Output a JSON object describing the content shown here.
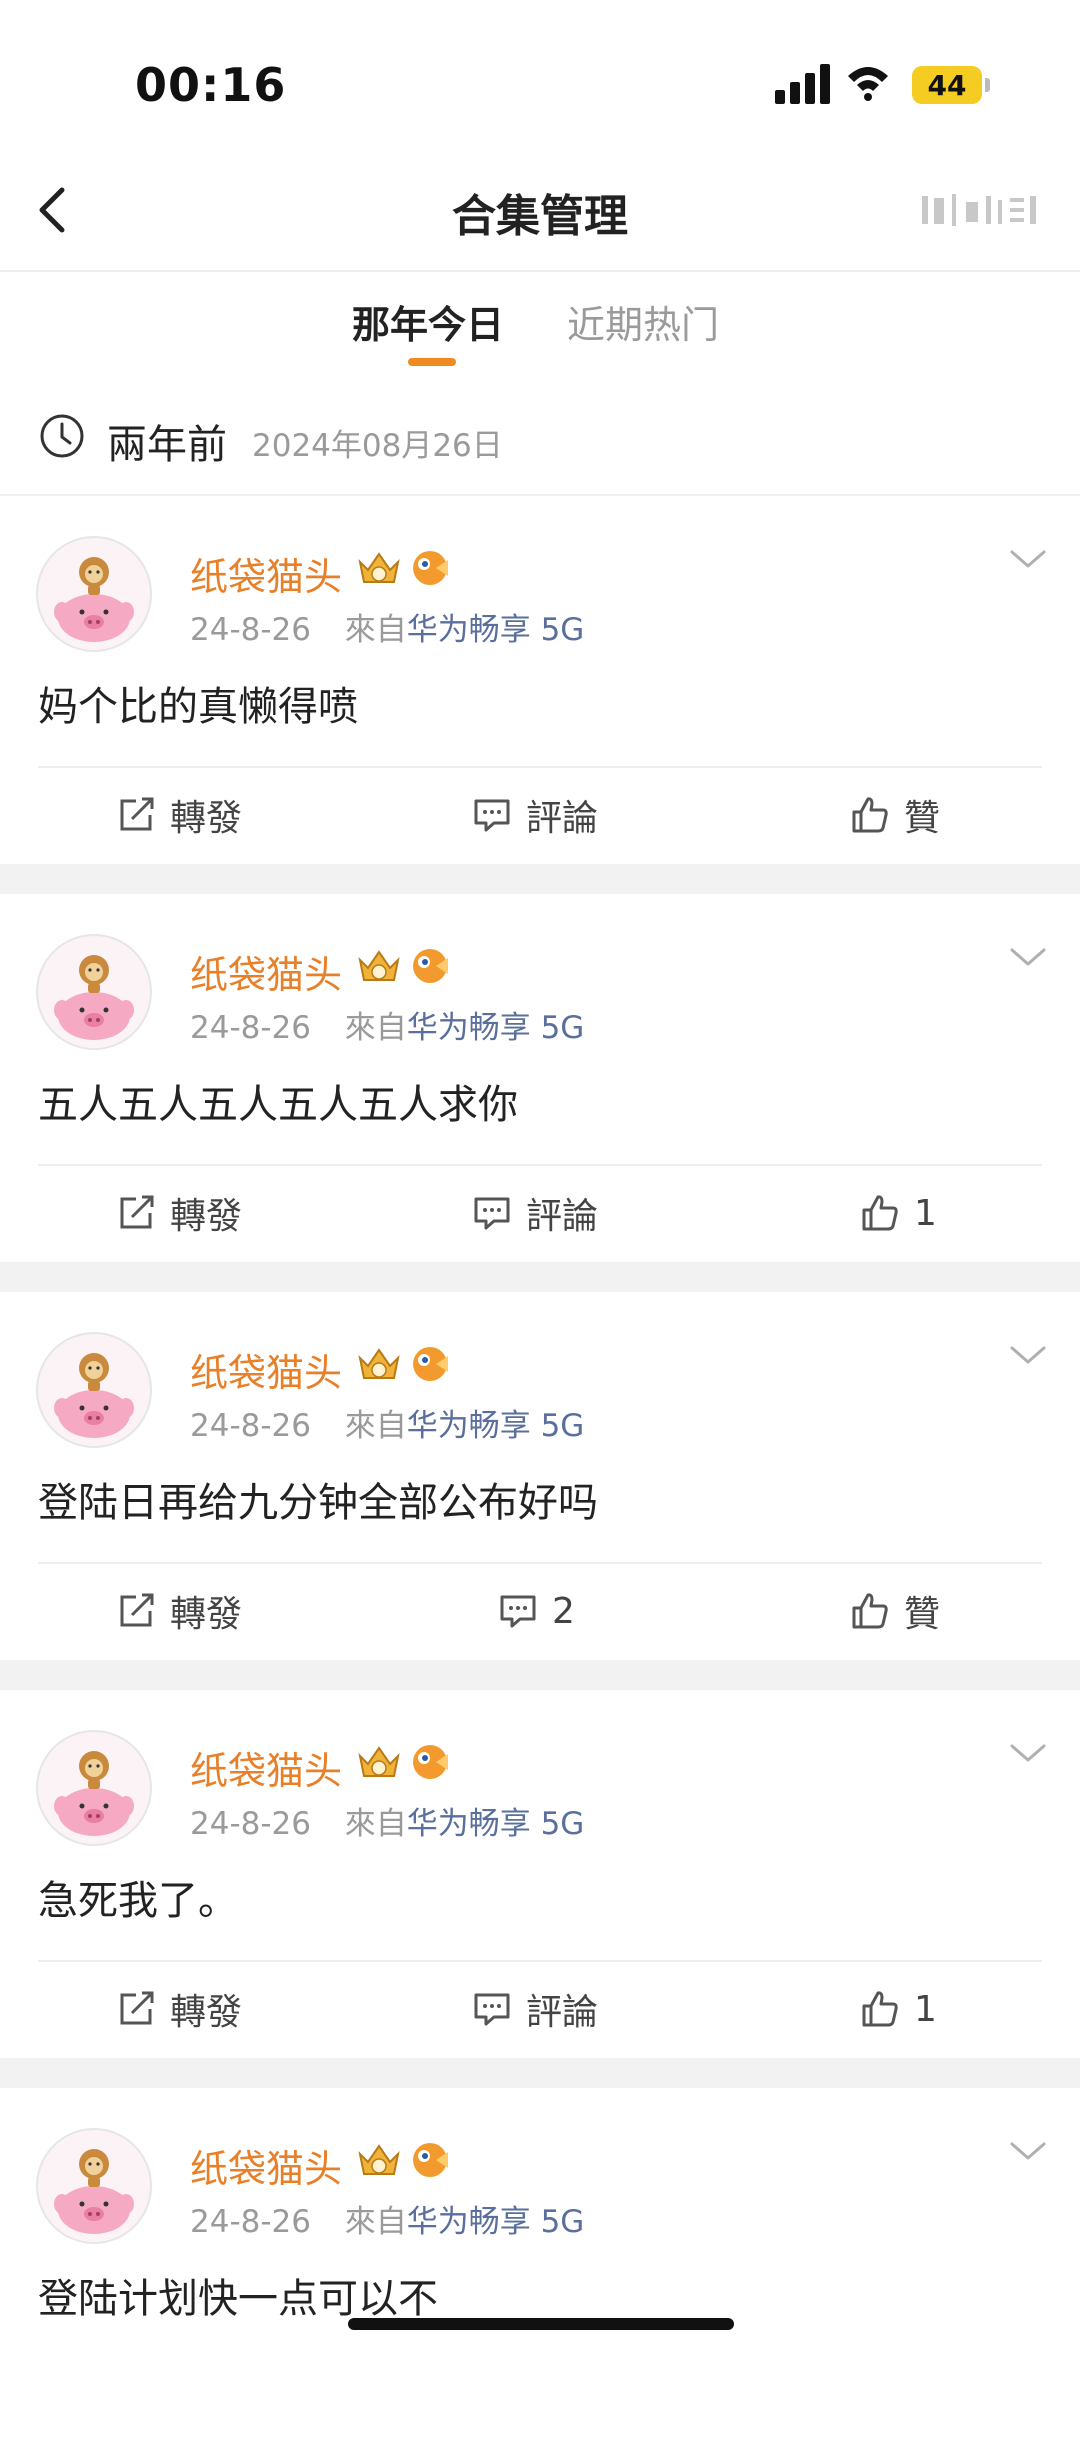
{
  "status_bar": {
    "time": "00:16",
    "battery": "44"
  },
  "nav": {
    "title": "合集管理"
  },
  "tabs": [
    {
      "label": "那年今日"
    },
    {
      "label": "近期热门"
    }
  ],
  "section": {
    "ago": "兩年前",
    "date": "2024年08月26日"
  },
  "posts": [
    {
      "username": "纸袋猫头",
      "date": "24-8-26",
      "from": "來自",
      "source": "华为畅享 5G",
      "content": "妈个比的真懒得喷",
      "repost": "轉發",
      "comment": "評論",
      "like": "贊"
    },
    {
      "username": "纸袋猫头",
      "date": "24-8-26",
      "from": "來自",
      "source": "华为畅享 5G",
      "content": "五人五人五人五人五人求你",
      "repost": "轉發",
      "comment": "評論",
      "like": "1"
    },
    {
      "username": "纸袋猫头",
      "date": "24-8-26",
      "from": "來自",
      "source": "华为畅享 5G",
      "content": "登陆日再给九分钟全部公布好吗",
      "repost": "轉發",
      "comment": "2",
      "like": "贊"
    },
    {
      "username": "纸袋猫头",
      "date": "24-8-26",
      "from": "來自",
      "source": "华为畅享 5G",
      "content": "急死我了。",
      "repost": "轉發",
      "comment": "評論",
      "like": "1"
    },
    {
      "username": "纸袋猫头",
      "date": "24-8-26",
      "from": "來自",
      "source": "华为畅享 5G",
      "content": "登陆计划快一点可以不"
    }
  ],
  "colors": {
    "accent": "#f08a23",
    "username": "#e8802a",
    "source_link": "#5a6f9c",
    "battery": "#f4cc22"
  }
}
